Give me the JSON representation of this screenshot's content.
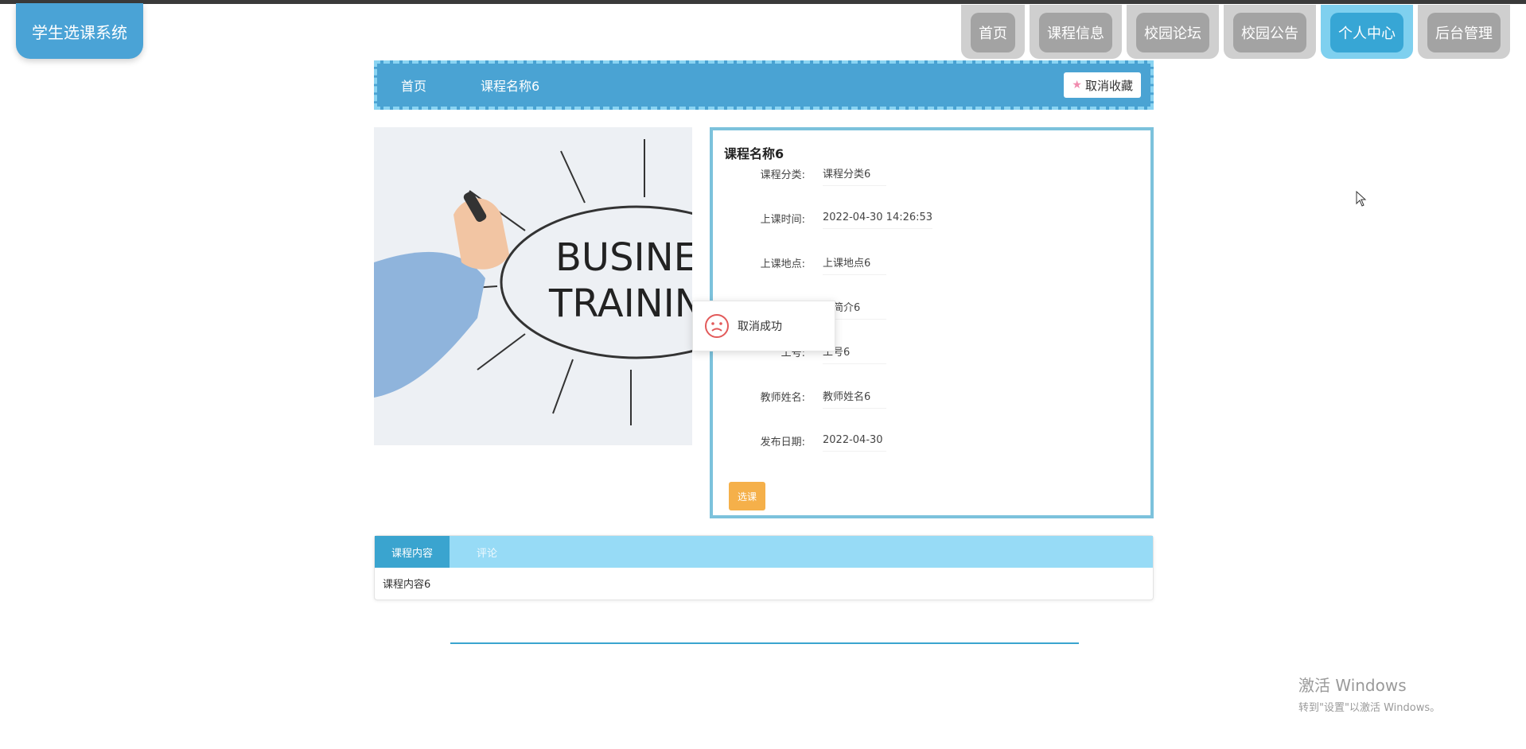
{
  "app": {
    "title": "学生选课系统"
  },
  "nav": {
    "items": [
      {
        "label": "首页",
        "active": false
      },
      {
        "label": "课程信息",
        "active": false
      },
      {
        "label": "校园论坛",
        "active": false
      },
      {
        "label": "校园公告",
        "active": false
      },
      {
        "label": "个人中心",
        "active": true
      },
      {
        "label": "后台管理",
        "active": false
      }
    ]
  },
  "breadcrumb": {
    "home": "首页",
    "current": "课程名称6"
  },
  "actions": {
    "unfavorite": "取消收藏",
    "select": "选课"
  },
  "image": {
    "text_line1": "BUSINES",
    "text_line2": "TRAININ"
  },
  "course": {
    "title": "课程名称6",
    "fields": [
      {
        "label": "课程分类:",
        "value": "课程分类6"
      },
      {
        "label": "上课时间:",
        "value": "2022-04-30 14:26:53"
      },
      {
        "label": "上课地点:",
        "value": "上课地点6"
      },
      {
        "label": "",
        "value": "程简介6"
      },
      {
        "label": "工号:",
        "value": "工号6"
      },
      {
        "label": "教师姓名:",
        "value": "教师姓名6"
      },
      {
        "label": "发布日期:",
        "value": "2022-04-30"
      }
    ]
  },
  "toast": {
    "message": "取消成功"
  },
  "tabs": {
    "items": [
      {
        "label": "课程内容"
      },
      {
        "label": "评论"
      }
    ],
    "content": "课程内容6"
  },
  "watermark": {
    "line1": "激活 Windows",
    "line2": "转到\"设置\"以激活 Windows。"
  },
  "colors": {
    "primary": "#4aa3d3",
    "accent_light": "#97dbf6",
    "button_orange": "#f5b04a"
  }
}
